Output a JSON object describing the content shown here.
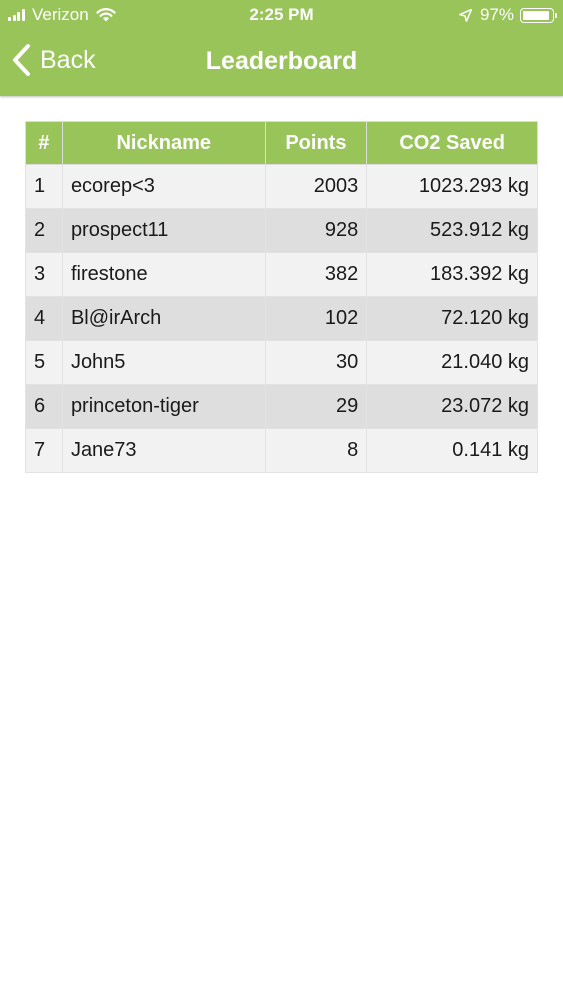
{
  "status_bar": {
    "carrier": "Verizon",
    "time": "2:25 PM",
    "battery": "97%",
    "battery_level": 0.97
  },
  "nav": {
    "back_label": "Back",
    "title": "Leaderboard"
  },
  "colors": {
    "accent": "#99c45a",
    "row_light": "#f2f2f2",
    "row_dark": "#dedede"
  },
  "table": {
    "columns": [
      "#",
      "Nickname",
      "Points",
      "CO2 Saved"
    ],
    "rows": [
      {
        "rank": "1",
        "nickname": "ecorep<3",
        "points": "2003",
        "co2": "1023.293 kg"
      },
      {
        "rank": "2",
        "nickname": "prospect11",
        "points": "928",
        "co2": "523.912 kg"
      },
      {
        "rank": "3",
        "nickname": "firestone",
        "points": "382",
        "co2": "183.392 kg"
      },
      {
        "rank": "4",
        "nickname": "Bl@irArch",
        "points": "102",
        "co2": "72.120 kg"
      },
      {
        "rank": "5",
        "nickname": "John5",
        "points": "30",
        "co2": "21.040 kg"
      },
      {
        "rank": "6",
        "nickname": "princeton-tiger",
        "points": "29",
        "co2": "23.072 kg"
      },
      {
        "rank": "7",
        "nickname": "Jane73",
        "points": "8",
        "co2": "0.141 kg"
      }
    ]
  }
}
